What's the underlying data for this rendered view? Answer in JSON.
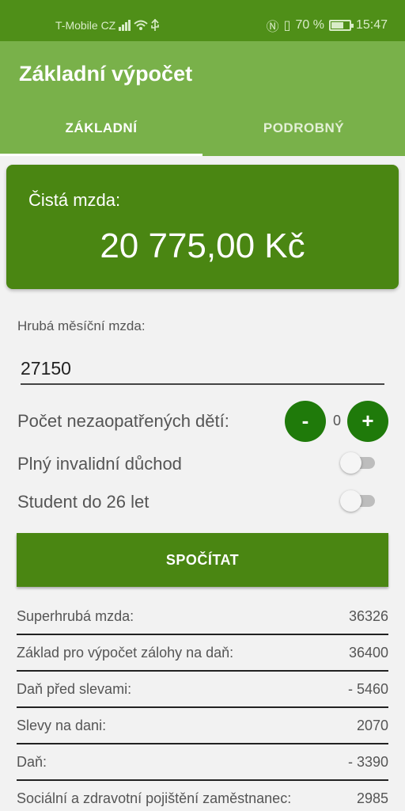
{
  "status_bar": {
    "carrier": "T-Mobile CZ",
    "battery": "70 %",
    "battery_level": 0.7,
    "time": "15:47",
    "icons": [
      "signal-icon",
      "wifi-icon",
      "usb-icon",
      "nfc-icon",
      "vibrate-icon",
      "battery-icon"
    ]
  },
  "app_bar": {
    "title": "Základní výpočet",
    "tabs": [
      {
        "label": "ZÁKLADNÍ",
        "active": true
      },
      {
        "label": "PODROBNÝ",
        "active": false
      }
    ]
  },
  "net_wage": {
    "label": "Čistá mzda:",
    "value": "20 775,00 Kč"
  },
  "form": {
    "gross_label": "Hrubá měsíční mzda:",
    "gross_value": "27150",
    "children_label": "Počet nezaopatřených dětí:",
    "children_count": "0",
    "minus_label": "-",
    "plus_label": "+",
    "disability_label": "Plný invalidní důchod",
    "disability_on": false,
    "student_label": "Student do 26 let",
    "student_on": false,
    "calculate_label": "SPOČÍTAT"
  },
  "results": [
    {
      "label": "Superhrubá mzda:",
      "value": "36326"
    },
    {
      "label": "Základ pro výpočet zálohy na daň:",
      "value": "36400"
    },
    {
      "label": "Daň před slevami:",
      "value": "- 5460"
    },
    {
      "label": "Slevy na dani:",
      "value": "2070"
    },
    {
      "label": "Daň:",
      "value": "- 3390"
    },
    {
      "label": "Sociální a zdravotní pojištění zaměstnanec:",
      "value": "2985"
    }
  ],
  "colors": {
    "status_bar": "#4f8f18",
    "app_bar": "#79b14a",
    "primary": "#4a8612",
    "round_button": "#1f7a0a"
  }
}
